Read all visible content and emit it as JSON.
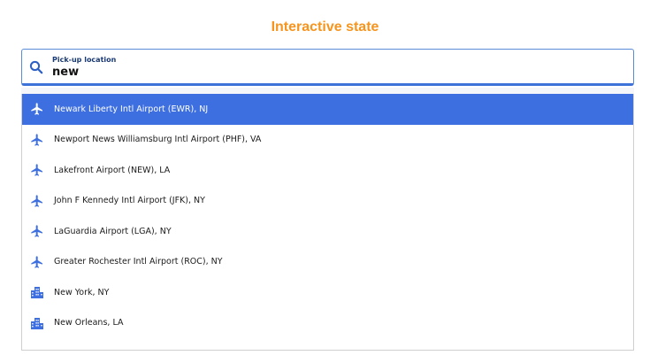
{
  "header": {
    "title": "Interactive state"
  },
  "search": {
    "label": "Pick-up location",
    "value": "new"
  },
  "colors": {
    "accent": "#f7941d",
    "primary": "#3d6fe0",
    "icon": "#3d6fe0"
  },
  "options": [
    {
      "label": "Newark Liberty Intl Airport (EWR), NJ",
      "icon": "airplane-icon",
      "selected": true
    },
    {
      "label": "Newport News Williamsburg Intl Airport (PHF), VA",
      "icon": "airplane-icon",
      "selected": false
    },
    {
      "label": "Lakefront Airport (NEW), LA",
      "icon": "airplane-icon",
      "selected": false
    },
    {
      "label": "John F Kennedy Intl Airport (JFK), NY",
      "icon": "airplane-icon",
      "selected": false
    },
    {
      "label": "LaGuardia Airport (LGA), NY",
      "icon": "airplane-icon",
      "selected": false
    },
    {
      "label": "Greater Rochester Intl Airport (ROC), NY",
      "icon": "airplane-icon",
      "selected": false
    },
    {
      "label": "New York, NY",
      "icon": "city-icon",
      "selected": false
    },
    {
      "label": "New Orleans, LA",
      "icon": "city-icon",
      "selected": false
    }
  ]
}
